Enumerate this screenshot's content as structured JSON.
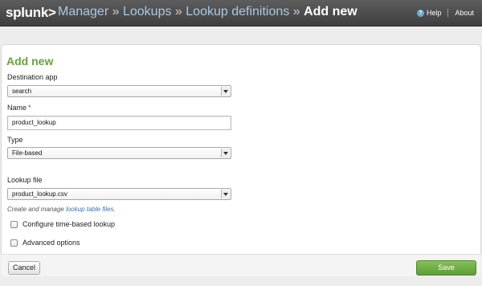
{
  "header": {
    "logo": "splunk>",
    "breadcrumbs": [
      "Manager",
      "Lookups",
      "Lookup definitions"
    ],
    "separator": "»",
    "current": "Add new",
    "help_label": "Help",
    "about_label": "About",
    "help_icon_glyph": "?"
  },
  "form": {
    "title": "Add new",
    "destination_app": {
      "label": "Destination app",
      "value": "search"
    },
    "name": {
      "label": "Name",
      "required_mark": "*",
      "value": "product_lookup"
    },
    "type": {
      "label": "Type",
      "value": "File-based"
    },
    "lookup_file": {
      "label": "Lookup file",
      "value": "product_lookup.csv"
    },
    "help_text_prefix": "Create and manage ",
    "help_text_link": "lookup table files",
    "help_text_suffix": ".",
    "time_based_label": "Configure time-based lookup",
    "advanced_label": "Advanced options"
  },
  "footer": {
    "cancel_label": "Cancel",
    "save_label": "Save"
  },
  "colors": {
    "title_green": "#6aa03d",
    "save_green": "#5e9c36",
    "link_blue": "#3a74b5",
    "header_bg": "#4a4a4a"
  }
}
